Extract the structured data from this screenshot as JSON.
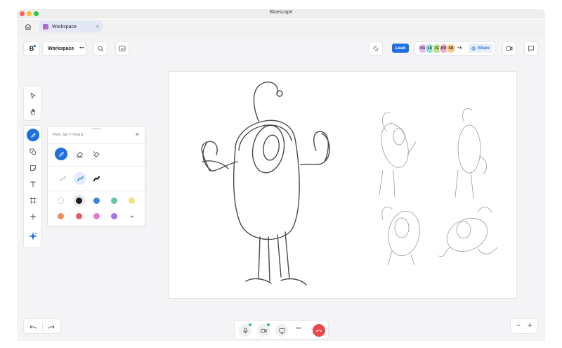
{
  "window": {
    "title": "Bluescape"
  },
  "traffic_colors": {
    "close": "#ff5f57",
    "minimize": "#febc2e",
    "maximize": "#28c840"
  },
  "tabbar": {
    "home_icon": "home-icon",
    "tab_label": "Workspace",
    "tab_close": "×"
  },
  "header": {
    "logo_text": "B",
    "workspace_label": "Workspace",
    "more_label": "•••",
    "lead_label": "Lead",
    "avatars": [
      {
        "initials": "SW",
        "color": "#e7b7f2"
      },
      {
        "initials": "LK",
        "color": "#8fe0d2"
      },
      {
        "initials": "JG",
        "color": "#b9e68a"
      },
      {
        "initials": "DW",
        "color": "#f2a5c8"
      },
      {
        "initials": "SB",
        "color": "#f6c98c"
      }
    ],
    "more_participants": "+6",
    "share_label": "Share"
  },
  "pen_panel": {
    "title": "PEN SETTINGS",
    "close": "×",
    "colors_row1": [
      "#ffffff",
      "#1e1e1e",
      "#3a82e6",
      "#5ec8a6",
      "#f3e27a"
    ],
    "colors_row2": [
      "#f08a5a",
      "#ea5a6a",
      "#e777d4",
      "#a771e8"
    ],
    "expand_icon": "chevron-down-icon"
  },
  "bottom_bar": {
    "more_label": "•••"
  },
  "zoom": {
    "minus": "−",
    "plus": "+"
  },
  "accent": "#1f6fde"
}
